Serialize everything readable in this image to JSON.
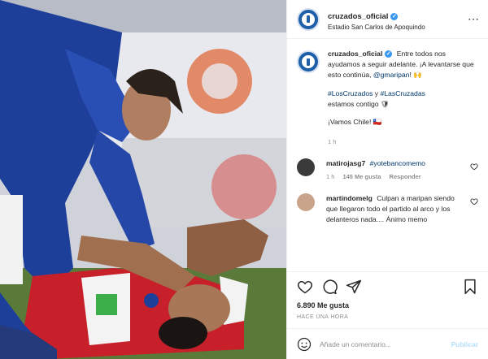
{
  "header": {
    "username": "cruzados_oficial",
    "location": "Estadio San Carlos de Apoquindo",
    "more_icon": "more-horizontal-icon"
  },
  "post": {
    "username": "cruzados_oficial",
    "text1": "Entre todos nos ayudamos a seguir adelante. ¡A levantarse que esto continúa, ",
    "mention": "@gmaripan",
    "text1_end": "! 🙌",
    "hashtag1": "#LosCruzados",
    "connector": " y ",
    "hashtag2": "#LasCruzadas",
    "text2": "estamos contigo 🛡",
    "text3": "¡Vamos Chile! 🇨🇱",
    "time": "1 h"
  },
  "comments": [
    {
      "username": "matirojasg7",
      "text": "#yotebancomemo",
      "time": "1 h",
      "likes": "145 Me gusta",
      "reply": "Responder"
    },
    {
      "username": "martindomelg",
      "text": "Culpan a maripan siendo que llegaron todo el partido al arco y los delanteros nada.... Ánimo memo"
    }
  ],
  "actions": {
    "likes": "6.890 Me gusta",
    "ago": "HACE UNA HORA"
  },
  "add_comment": {
    "placeholder": "Añade un comentario...",
    "publish": "Publicar"
  },
  "colors": {
    "club_blue": "#1f5fa8",
    "link": "#00376b",
    "verified": "#3897f0",
    "publish_disabled": "#b2dffc"
  }
}
